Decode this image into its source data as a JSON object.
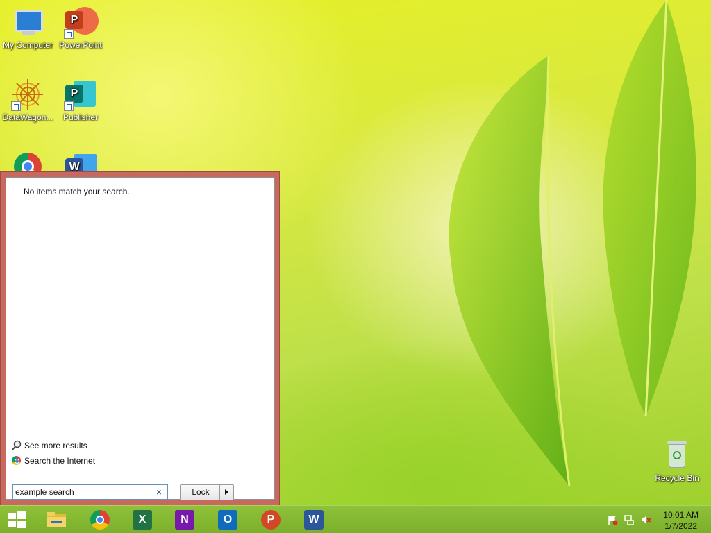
{
  "desktop": {
    "icons": {
      "my_computer": "My Computer",
      "powerpoint": "PowerPoint",
      "datawagon": "DataWagon...",
      "publisher": "Publisher",
      "recycle_bin": "Recycle Bin"
    }
  },
  "start_menu": {
    "no_items_text": "No items match your search.",
    "see_more_results": "See more results",
    "search_internet": "Search the Internet",
    "search_value": "example search",
    "lock_label": "Lock",
    "clear_icon": "×"
  },
  "taskbar": {
    "apps": [
      "start-icon",
      "file-explorer-icon",
      "chrome-icon",
      "excel-icon",
      "onenote-icon",
      "outlook-icon",
      "powerpoint-icon",
      "word-icon"
    ],
    "tray_icons": [
      "action-center-flag-icon",
      "network-icon",
      "volume-muted-icon"
    ],
    "time": "10:01 AM",
    "date": "1/7/2022"
  },
  "colors": {
    "powerpoint": "#d24726",
    "publisher": "#077568",
    "word": "#2b579a",
    "excel": "#217346",
    "onenote": "#7719aa",
    "outlook": "#0f6cbd",
    "start_menu_frame": "#c8695f"
  }
}
